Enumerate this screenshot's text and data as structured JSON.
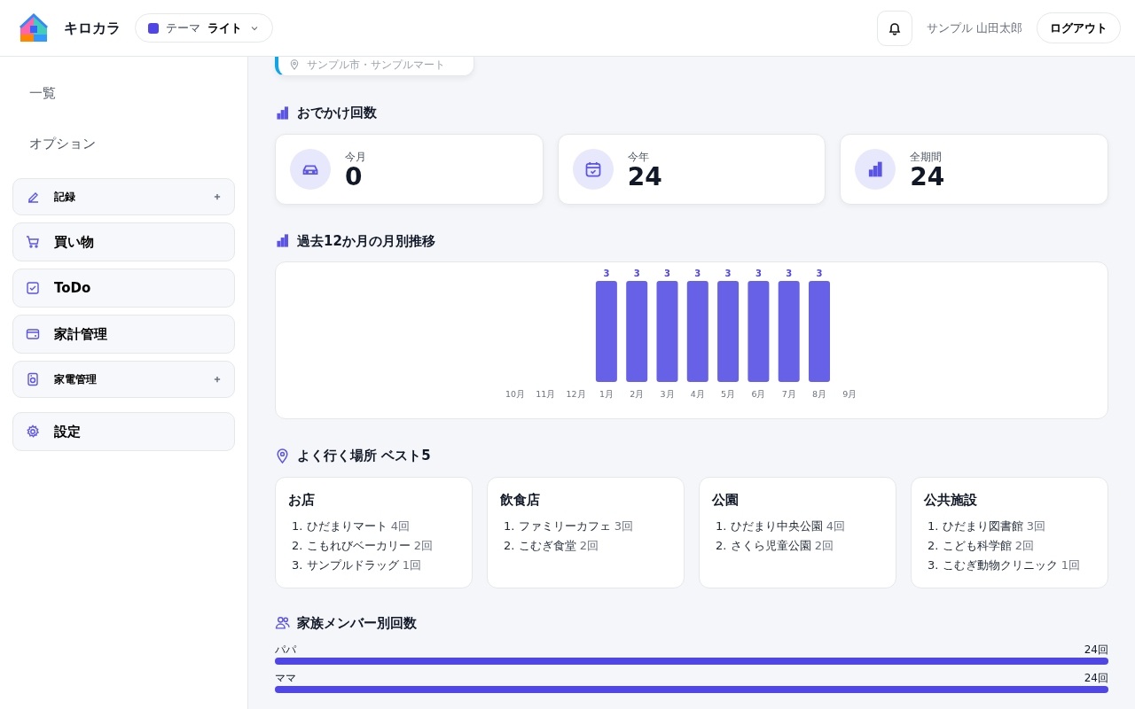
{
  "app": {
    "title": "キロカラ"
  },
  "theme": {
    "label": "テーマ",
    "value": "ライト",
    "color": "#4f46e5"
  },
  "user": {
    "name": "サンプル 山田太郎",
    "logout": "ログアウト"
  },
  "sidebar": {
    "links": [
      {
        "label": "一覧"
      },
      {
        "label": "オプション"
      }
    ],
    "items": [
      {
        "label": "記録",
        "kind": "group"
      },
      {
        "label": "買い物",
        "kind": "link"
      },
      {
        "label": "ToDo",
        "kind": "link"
      },
      {
        "label": "家計管理",
        "kind": "link"
      },
      {
        "label": "家電管理",
        "kind": "group"
      },
      {
        "label": "設定",
        "kind": "link"
      }
    ]
  },
  "recent": {
    "location": "サンプル市・サンプルマート"
  },
  "outings": {
    "title": "おでかけ回数",
    "stats": [
      {
        "label": "今月",
        "value": "0"
      },
      {
        "label": "今年",
        "value": "24"
      },
      {
        "label": "全期間",
        "value": "24"
      }
    ]
  },
  "monthly": {
    "title": "過去12か月の月別推移",
    "chart_data": {
      "type": "bar",
      "categories": [
        "10月",
        "11月",
        "12月",
        "1月",
        "2月",
        "3月",
        "4月",
        "5月",
        "6月",
        "7月",
        "8月",
        "9月"
      ],
      "series": [
        {
          "color": "#6761e8",
          "values": [
            null,
            null,
            null,
            3,
            3,
            3,
            3,
            3,
            3,
            3,
            3,
            null
          ]
        }
      ],
      "data_labels": true
    }
  },
  "places": {
    "title": "よく行く場所 ベスト5",
    "groups": [
      {
        "name": "お店",
        "items": [
          {
            "rank": "1.",
            "name": "ひだまりマート",
            "count": "4回"
          },
          {
            "rank": "2.",
            "name": "こもれびベーカリー",
            "count": "2回"
          },
          {
            "rank": "3.",
            "name": "サンプルドラッグ",
            "count": "1回"
          }
        ]
      },
      {
        "name": "飲食店",
        "items": [
          {
            "rank": "1.",
            "name": "ファミリーカフェ",
            "count": "3回"
          },
          {
            "rank": "2.",
            "name": "こむぎ食堂",
            "count": "2回"
          }
        ]
      },
      {
        "name": "公園",
        "items": [
          {
            "rank": "1.",
            "name": "ひだまり中央公園",
            "count": "4回"
          },
          {
            "rank": "2.",
            "name": "さくら児童公園",
            "count": "2回"
          }
        ]
      },
      {
        "name": "公共施設",
        "items": [
          {
            "rank": "1.",
            "name": "ひだまり図書館",
            "count": "3回"
          },
          {
            "rank": "2.",
            "name": "こども科学館",
            "count": "2回"
          },
          {
            "rank": "3.",
            "name": "こむぎ動物クリニック",
            "count": "1回"
          }
        ]
      }
    ]
  },
  "members": {
    "title": "家族メンバー別回数",
    "rows": [
      {
        "name": "パパ",
        "count": "24回",
        "level": 1
      },
      {
        "name": "ママ",
        "count": "24回",
        "level": 1
      }
    ]
  }
}
